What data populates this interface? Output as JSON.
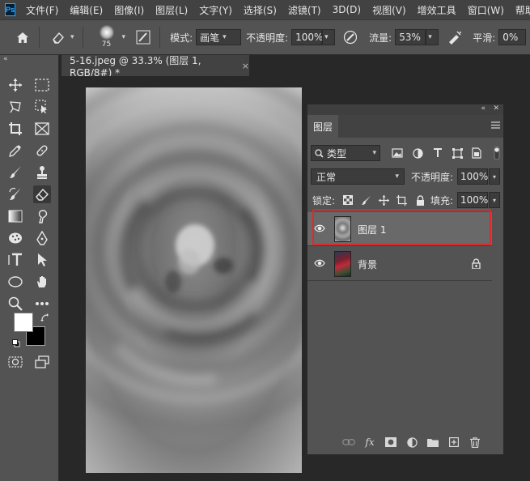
{
  "menubar": {
    "logo": "Ps",
    "items": [
      "文件(F)",
      "编辑(E)",
      "图像(I)",
      "图层(L)",
      "文字(Y)",
      "选择(S)",
      "滤镜(T)",
      "3D(D)",
      "视图(V)",
      "增效工具",
      "窗口(W)",
      "帮助(H)"
    ]
  },
  "options": {
    "brush_size": "75",
    "mode_label": "模式:",
    "mode_value": "画笔",
    "opacity_label": "不透明度:",
    "opacity_value": "100%",
    "flow_label": "流量:",
    "flow_value": "53%",
    "smooth_label": "平滑:",
    "smooth_value": "0%"
  },
  "toolbar": {
    "collapse": "«",
    "foreground_color": "#ffffff",
    "background_color": "#000000"
  },
  "document": {
    "tab_title": "5-16.jpeg @ 33.3% (图层 1, RGB/8#) *",
    "close": "×"
  },
  "layers_panel": {
    "tab_label": "图层",
    "filter_label": "类型",
    "blend_mode": "正常",
    "opacity_label": "不透明度:",
    "opacity_value": "100%",
    "lock_label": "锁定:",
    "fill_label": "填充:",
    "fill_value": "100%",
    "layers": [
      {
        "name": "图层 1",
        "selected": true,
        "locked": false
      },
      {
        "name": "背景",
        "selected": false,
        "locked": true
      }
    ]
  },
  "colors": {
    "accent_selection": "#e0292b",
    "brand": "#31a8ff"
  }
}
